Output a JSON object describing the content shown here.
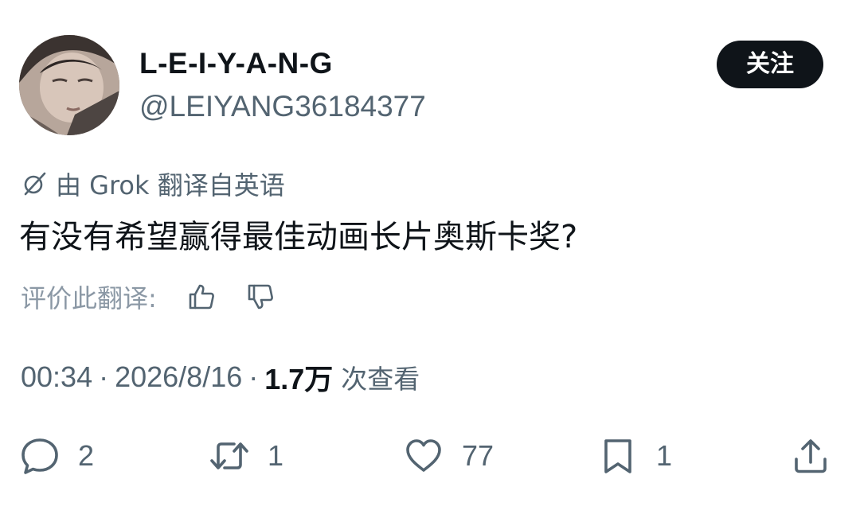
{
  "author": {
    "display_name": "L-E-I-Y-A-N-G",
    "handle": "@LEIYANG36184377",
    "avatar_icon": "user-avatar"
  },
  "follow_button": {
    "label": "关注"
  },
  "translation": {
    "note": "由 Grok 翻译自英语",
    "icon": "grok-icon"
  },
  "tweet": {
    "text": "有没有希望赢得最佳动画长片奥斯卡奖?"
  },
  "rating": {
    "label": "评价此翻译:",
    "up_icon": "thumbs-up-icon",
    "down_icon": "thumbs-down-icon"
  },
  "meta": {
    "time": "00:34",
    "date": "2026/8/16",
    "separator": "·",
    "views_count": "1.7万",
    "views_label": "次查看"
  },
  "actions": {
    "reply_count": "2",
    "retweet_count": "1",
    "like_count": "77",
    "bookmark_count": "1"
  },
  "colors": {
    "primary_text": "#0f1419",
    "secondary_text": "#536471",
    "button_bg": "#0f1419",
    "button_text": "#ffffff"
  }
}
